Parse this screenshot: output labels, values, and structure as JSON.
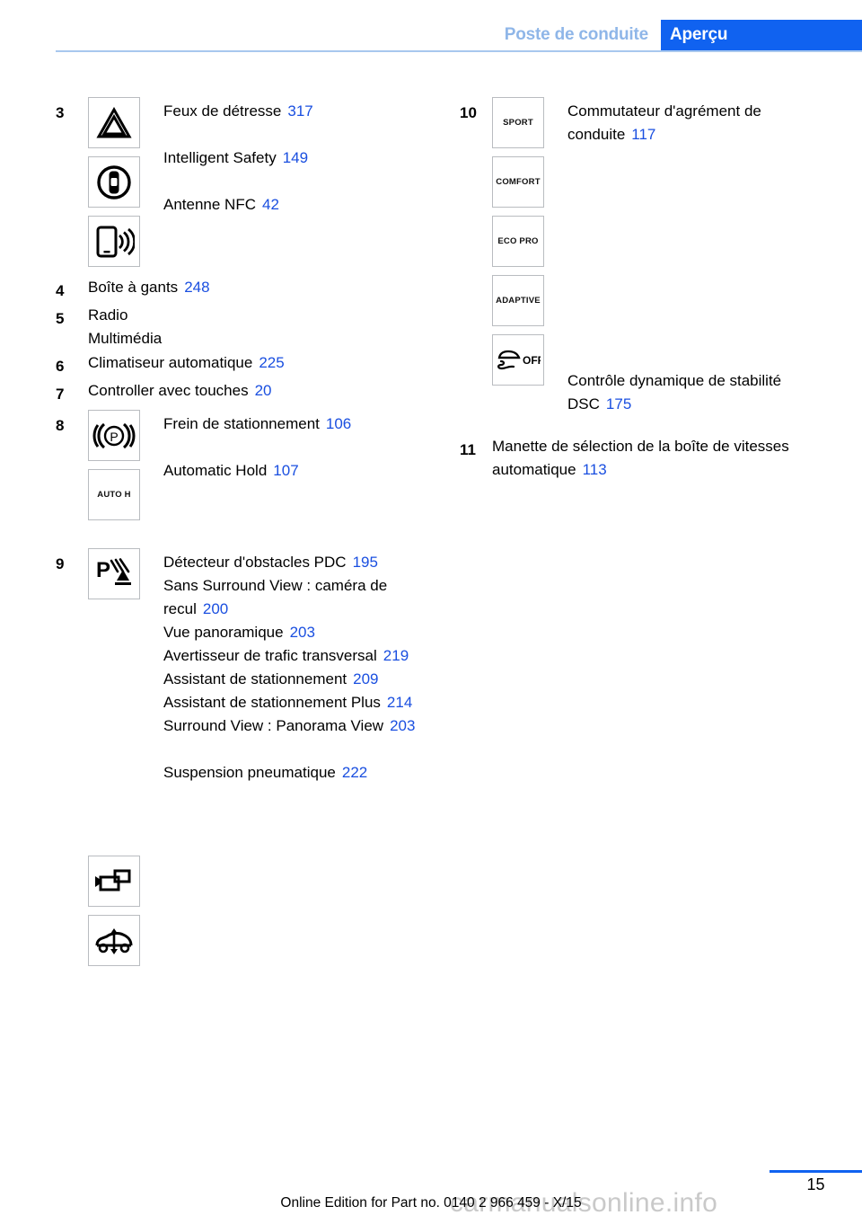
{
  "header": {
    "chapter": "Poste de conduite",
    "section": "Aperçu",
    "tab_color": "#1062f0",
    "chapter_color": "#8fb6e8"
  },
  "colors": {
    "page_ref": "#1a4fe0",
    "rule": "#a8c8ee",
    "icon_border": "#b9bcc0",
    "watermark": "#c9c9c9"
  },
  "left_column": [
    {
      "number": "3",
      "entries": [
        {
          "icon": "hazard-warning-triangle-icon",
          "icon_label": "",
          "label": "Feux de détresse",
          "page": "317"
        },
        {
          "icon": "intelligent-safety-car-in-circle-icon",
          "icon_label": "",
          "label": "Intelligent Safety",
          "page": "149"
        },
        {
          "icon": "nfc-antenna-phone-waves-icon",
          "icon_label": "",
          "label": "Antenne NFC",
          "page": "42"
        }
      ]
    },
    {
      "number": "4",
      "entries": [
        {
          "icon": "",
          "icon_label": "",
          "label": "Boîte à gants",
          "page": "248"
        }
      ]
    },
    {
      "number": "5",
      "entries": [
        {
          "icon": "",
          "icon_label": "",
          "label": "Radio",
          "page": ""
        },
        {
          "icon": "",
          "icon_label": "",
          "label": "Multimédia",
          "page": ""
        }
      ]
    },
    {
      "number": "6",
      "entries": [
        {
          "icon": "",
          "icon_label": "",
          "label": "Climatiseur automatique",
          "page": "225"
        }
      ]
    },
    {
      "number": "7",
      "entries": [
        {
          "icon": "",
          "icon_label": "",
          "label": "Controller avec touches",
          "page": "20"
        }
      ]
    },
    {
      "number": "8",
      "entries": [
        {
          "icon": "parking-brake-p-in-brackets-icon",
          "icon_label": "",
          "label": "Frein de stationnement",
          "page": "106"
        },
        {
          "icon": "auto-hold-icon",
          "icon_label": "AUTO H",
          "label": "Automatic Hold",
          "page": "107"
        }
      ]
    },
    {
      "number": "9",
      "entries": [
        {
          "icon": "pdc-parking-sonar-icon",
          "icon_label": "",
          "label": "Détecteur d'obstacles PDC",
          "page": "195"
        },
        {
          "icon": "",
          "icon_label": "",
          "label": "Sans Surround View : caméra de recul",
          "page": "200"
        },
        {
          "icon": "",
          "icon_label": "",
          "label": "Vue panoramique",
          "page": "203"
        },
        {
          "icon": "",
          "icon_label": "",
          "label": "Avertisseur de trafic transversal",
          "page": "219"
        },
        {
          "icon": "",
          "icon_label": "",
          "label": "Assistant de stationnement",
          "page": "209"
        },
        {
          "icon": "",
          "icon_label": "",
          "label": "Assistant de stationnement Plus",
          "page": "214"
        },
        {
          "icon": "surround-view-camera-icon",
          "icon_label": "",
          "label": "Surround View : Panorama View",
          "page": "203"
        },
        {
          "icon": "air-suspension-car-arrows-icon",
          "icon_label": "",
          "label": "Suspension pneumatique",
          "page": "222"
        }
      ]
    }
  ],
  "right_column": [
    {
      "number": "10",
      "entries": [
        {
          "icon": "sport-mode-button-icon",
          "icon_label": "SPORT",
          "label": "Commutateur d'agrément de conduite",
          "page": "117"
        },
        {
          "icon": "comfort-mode-button-icon",
          "icon_label": "COMFORT",
          "label": "",
          "page": ""
        },
        {
          "icon": "eco-pro-mode-button-icon",
          "icon_label": "ECO PRO",
          "label": "",
          "page": ""
        },
        {
          "icon": "adaptive-mode-button-icon",
          "icon_label": "ADAPTIVE",
          "label": "",
          "page": ""
        },
        {
          "icon": "dsc-off-icon",
          "icon_label": "OFF",
          "label": "Contrôle dynamique de stabilité DSC",
          "page": "175"
        }
      ]
    },
    {
      "number": "11",
      "entries": [
        {
          "icon": "",
          "icon_label": "",
          "label": "Manette de sélection de la boîte de vitesses automatique",
          "page": "113"
        }
      ]
    }
  ],
  "footer": {
    "page_number": "15",
    "edition": "Online Edition for Part no. 0140 2 966 459 - X/15",
    "watermark": "carmanualsonline.info"
  }
}
